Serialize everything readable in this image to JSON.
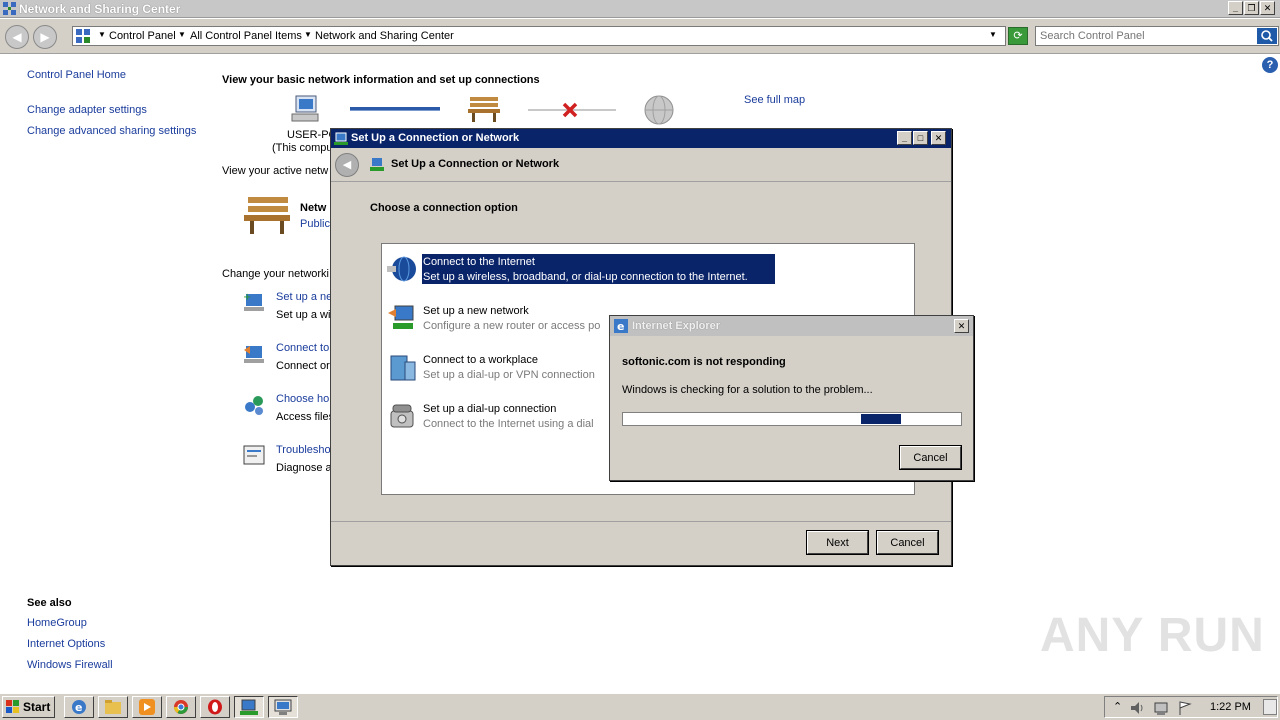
{
  "window": {
    "title": "Network and Sharing Center"
  },
  "addressbar": {
    "crumbs": [
      "Control Panel",
      "All Control Panel Items",
      "Network and Sharing Center"
    ],
    "search_placeholder": "Search Control Panel"
  },
  "left_pane": {
    "links": [
      "Control Panel Home",
      "Change adapter settings",
      "Change advanced sharing settings"
    ],
    "see_also_heading": "See also",
    "see_also_links": [
      "HomeGroup",
      "Internet Options",
      "Windows Firewall"
    ]
  },
  "main": {
    "heading": "View your basic network information and set up connections",
    "computer_name": "USER-PC",
    "computer_sub": "(This compu",
    "see_full_map": "See full map",
    "active_networks": "View your active netw",
    "network_name": "Netw",
    "network_type": "Public",
    "change_networking": "Change your networki",
    "tasks": [
      {
        "title": "Set up a ne",
        "desc": "Set up a wi"
      },
      {
        "title": "Connect to",
        "desc": "Connect or"
      },
      {
        "title": "Choose hor",
        "desc": "Access files"
      },
      {
        "title": "Troublesho",
        "desc": "Diagnose a"
      }
    ]
  },
  "setup_dialog": {
    "title": "Set Up a Connection or Network",
    "header": "Set Up a Connection or Network",
    "prompt": "Choose a connection option",
    "options": [
      {
        "title": "Connect to the Internet",
        "desc": "Set up a wireless, broadband, or dial-up connection to the Internet."
      },
      {
        "title": "Set up a new network",
        "desc": "Configure a new router or access po"
      },
      {
        "title": "Connect to a workplace",
        "desc": "Set up a dial-up or VPN connection"
      },
      {
        "title": "Set up a dial-up connection",
        "desc": "Connect to the Internet using a dial"
      }
    ],
    "next_label": "Next",
    "cancel_label": "Cancel"
  },
  "ie_dialog": {
    "title": "Internet Explorer",
    "message": "softonic.com is not responding",
    "status": "Windows is checking for a solution to the problem...",
    "cancel_label": "Cancel",
    "progress": 0.8
  },
  "taskbar": {
    "start_label": "Start",
    "clock": "1:22 PM"
  },
  "watermark": "ANY RUN",
  "colors": {
    "link": "#1a3c9c",
    "selection": "#0a246a",
    "dialog_bg": "#d4d0c8"
  }
}
